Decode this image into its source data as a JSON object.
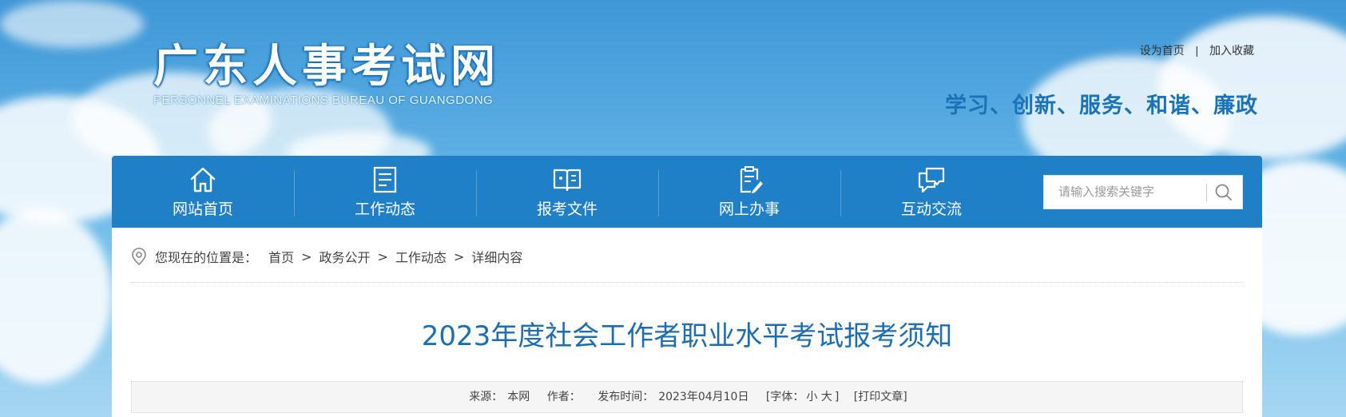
{
  "header": {
    "site_title": "广东人事考试网",
    "site_subtitle": "PERSONNEL EXAMINATIONS BUREAU OF GUANGDONG",
    "top_links": {
      "set_home": "设为首页",
      "separator": "|",
      "add_favorite": "加入收藏"
    },
    "slogan": "学习、创新、服务、和谐、廉政"
  },
  "nav": {
    "items": [
      {
        "label": "网站首页",
        "icon": "home-icon"
      },
      {
        "label": "工作动态",
        "icon": "document-list-icon"
      },
      {
        "label": "报考文件",
        "icon": "open-book-icon"
      },
      {
        "label": "网上办事",
        "icon": "clipboard-edit-icon"
      },
      {
        "label": "互动交流",
        "icon": "chat-bubbles-icon"
      }
    ],
    "search": {
      "placeholder": "请输入搜索关键字",
      "icon": "search-icon"
    }
  },
  "breadcrumb": {
    "icon": "location-pin-icon",
    "label": "您现在的位置是：",
    "items": [
      "首页",
      "政务公开",
      "工作动态",
      "详细内容"
    ],
    "separator": ">"
  },
  "article": {
    "title": "2023年度社会工作者职业水平考试报考须知",
    "meta": {
      "source_label": "来源：",
      "source": "本网",
      "author_label": "作者：",
      "published_label": "发布时间：",
      "published": "2023年04月10日",
      "font_size_label": "[字体：",
      "font_small": "小",
      "font_large": "大",
      "font_close": "]",
      "print": "[打印文章]"
    }
  },
  "colors": {
    "nav_bg": "#1f80c8",
    "title": "#1d6db3",
    "slogan": "#1a73b6"
  }
}
